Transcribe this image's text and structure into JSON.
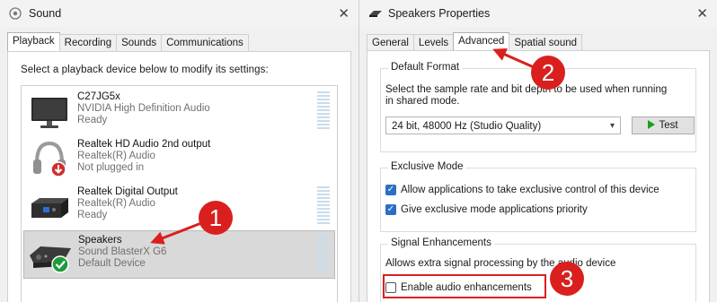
{
  "sound": {
    "title": "Sound",
    "tabs": [
      "Playback",
      "Recording",
      "Sounds",
      "Communications"
    ],
    "active_tab": "Playback",
    "instruction": "Select a playback device below to modify its settings:",
    "devices": [
      {
        "name": "C27JG5x",
        "driver": "NVIDIA High Definition Audio",
        "status": "Ready",
        "icon": "monitor-icon"
      },
      {
        "name": "Realtek HD Audio 2nd output",
        "driver": "Realtek(R) Audio",
        "status": "Not plugged in",
        "icon": "headphones-icon"
      },
      {
        "name": "Realtek Digital Output",
        "driver": "Realtek(R) Audio",
        "status": "Ready",
        "icon": "digital-output-icon"
      },
      {
        "name": "Speakers",
        "driver": "Sound BlasterX G6",
        "status": "Default Device",
        "icon": "sound-card-icon"
      }
    ]
  },
  "props": {
    "title": "Speakers Properties",
    "tabs": [
      "General",
      "Levels",
      "Advanced",
      "Spatial sound"
    ],
    "active_tab": "Advanced",
    "default_format": {
      "group_title": "Default Format",
      "description_line1": "Select the sample rate and bit depth to be used when running",
      "description_line2": "in shared mode.",
      "selected_format": "24 bit, 48000 Hz (Studio Quality)",
      "test_label": "Test"
    },
    "exclusive_mode": {
      "group_title": "Exclusive Mode",
      "option1": "Allow applications to take exclusive control of this device",
      "option1_checked": true,
      "option2": "Give exclusive mode applications priority",
      "option2_checked": true
    },
    "signal_enhancements": {
      "group_title": "Signal Enhancements",
      "description": "Allows extra signal processing by the audio device",
      "option": "Enable audio enhancements",
      "option_checked": false
    }
  },
  "annotations": {
    "step1": "1",
    "step2": "2",
    "step3": "3",
    "color": "#d9201e"
  }
}
